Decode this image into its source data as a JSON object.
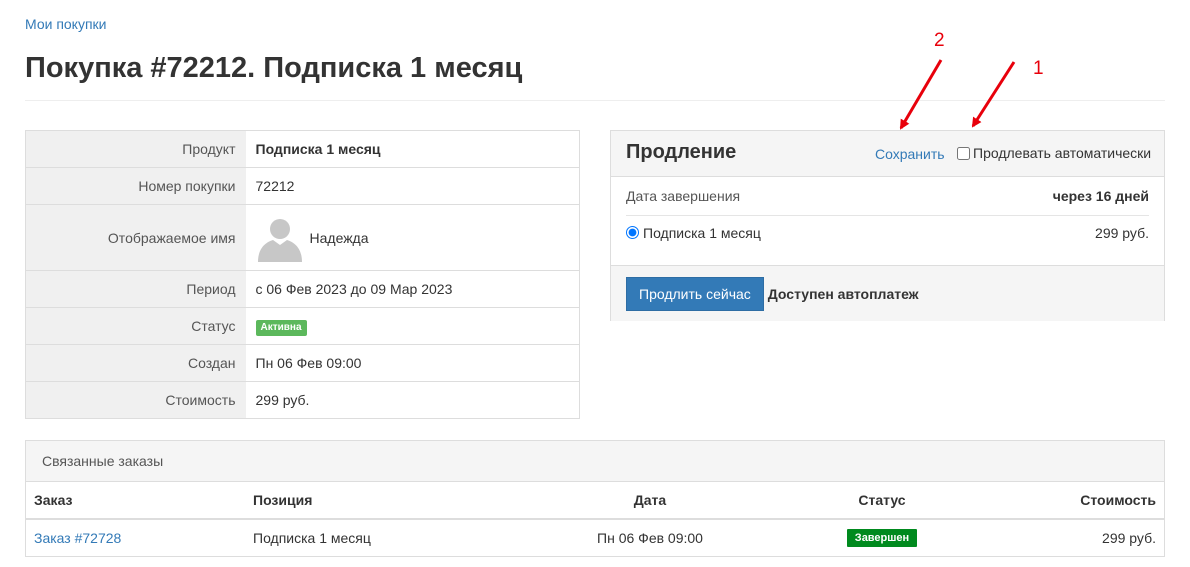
{
  "breadcrumb": {
    "label": "Мои покупки"
  },
  "page": {
    "title": "Покупка #72212. Подписка 1 месяц"
  },
  "info": {
    "rows": [
      {
        "label": "Продукт",
        "value": "Подписка 1 месяц"
      },
      {
        "label": "Номер покупки",
        "value": "72212"
      },
      {
        "label": "Отображаемое имя",
        "value": "Надежда"
      },
      {
        "label": "Период",
        "value": "с 06 Фев 2023 до 09 Мар 2023"
      },
      {
        "label": "Статус",
        "value": "Активна"
      },
      {
        "label": "Создан",
        "value": "Пн 06 Фев 09:00"
      },
      {
        "label": "Стоимость",
        "value": "299 руб."
      }
    ],
    "avatar_icon": "user-silhouette-icon"
  },
  "renewal": {
    "title": "Продление",
    "save_label": "Сохранить",
    "auto_renew_label": "Продлевать автоматически",
    "auto_renew_checked": false,
    "end_date_label": "Дата завершения",
    "end_date_value": "через 16 дней",
    "plan_label": "Подписка 1 месяц",
    "plan_price": "299 руб.",
    "plan_selected": true,
    "renew_button": "Продлить сейчас",
    "autopay_text": "Доступен автоплатеж"
  },
  "orders": {
    "title": "Связанные заказы",
    "columns": [
      "Заказ",
      "Позиция",
      "Дата",
      "Статус",
      "Стоимость"
    ],
    "rows": [
      {
        "order": "Заказ #72728",
        "item": "Подписка 1 месяц",
        "date": "Пн 06 Фев 09:00",
        "status": "Завершен",
        "cost": "299 руб."
      }
    ]
  },
  "annotations": {
    "one": "1",
    "two": "2",
    "color": "#e8000b"
  },
  "colors": {
    "link": "#337ab7",
    "active_badge": "#5cb85c",
    "done_badge": "#008a1e",
    "primary_button": "#337ab7"
  }
}
